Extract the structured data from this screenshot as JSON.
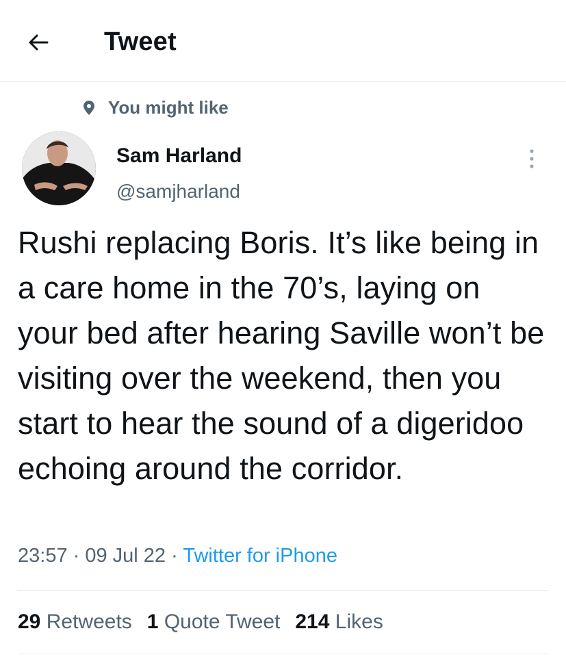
{
  "header": {
    "title": "Tweet",
    "back_icon": "arrow-left-icon"
  },
  "context": {
    "label": "You might like",
    "icon": "location-pin-icon"
  },
  "author": {
    "name": "Sam Harland",
    "handle": "@samjharland",
    "avatar": "avatar-photo"
  },
  "tweet": {
    "text": "Rushi replacing Boris. It’s like being in a care home in the 70’s, laying on your bed after hearing Saville won’t be visiting over the weekend, then you start to hear the sound of a digeridoo echoing around the corridor.",
    "time": "23:57",
    "date": "09 Jul 22",
    "source": "Twitter for iPhone"
  },
  "stats": {
    "retweets_count": "29",
    "retweets_label": "Retweets",
    "quotes_count": "1",
    "quotes_label": "Quote Tweet",
    "likes_count": "214",
    "likes_label": "Likes"
  },
  "colors": {
    "link": "#1d9bf0",
    "secondary": "#536471",
    "primary_text": "#0f1419"
  }
}
